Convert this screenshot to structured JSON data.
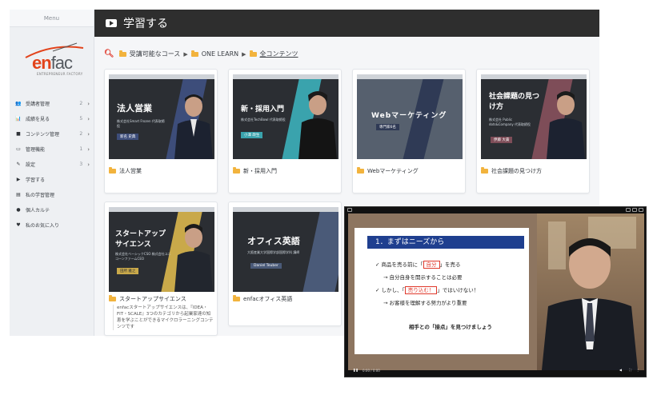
{
  "sidebar": {
    "menu_title": "Menu",
    "logo": {
      "en": "en",
      "fac": "fac",
      "tagline": "ENTREPRENEUR FACTORY"
    },
    "items": [
      {
        "icon": "users-icon",
        "glyph": "👥",
        "label": "受講者管理",
        "count": "2",
        "chevron": "›"
      },
      {
        "icon": "chart-icon",
        "glyph": "📊",
        "label": "成績を見る",
        "count": "5",
        "chevron": "›"
      },
      {
        "icon": "folder-icon",
        "glyph": "■",
        "label": "コンテンツ管理",
        "count": "2",
        "chevron": "›"
      },
      {
        "icon": "monitor-icon",
        "glyph": "▭",
        "label": "管理機能",
        "count": "1",
        "chevron": "›"
      },
      {
        "icon": "wrench-icon",
        "glyph": "✎",
        "label": "設定",
        "count": "3",
        "chevron": "›"
      },
      {
        "icon": "play-icon",
        "glyph": "▶",
        "label": "学習する",
        "count": "",
        "chevron": ""
      },
      {
        "icon": "bar-chart-icon",
        "glyph": "▤",
        "label": "私の学習管理",
        "count": "",
        "chevron": ""
      },
      {
        "icon": "id-card-icon",
        "glyph": "●",
        "label": "個人カルテ",
        "count": "",
        "chevron": ""
      },
      {
        "icon": "heart-icon",
        "glyph": "♥",
        "label": "私のお気に入り",
        "count": "",
        "chevron": ""
      }
    ]
  },
  "header": {
    "title": "学習する"
  },
  "breadcrumb": {
    "items": [
      "受講可能なコース",
      "ONE LEARN",
      "全コンテンツ"
    ]
  },
  "cards": [
    {
      "title": "法人営業",
      "thumb_title": "法人営業",
      "thumb_sub": "株式会社Smart Frozen 代表取締役",
      "thumb_name": "新名 史典",
      "bg": "#2b2e33",
      "accent": "#3d4d7a"
    },
    {
      "title": "新・採用入門",
      "thumb_title": "新・採用入門",
      "thumb_sub": "株式会社TechBowl 代表取締役",
      "thumb_name": "小澤 政生",
      "bg": "#2b2e33",
      "accent": "#3aa3ad"
    },
    {
      "title": "Webマーケティング",
      "thumb_title": "Webマーケティング",
      "thumb_name": "専門家6名",
      "bg": "#56606e",
      "accent": "#2f3a55"
    },
    {
      "title": "社会課題の見つけ方",
      "thumb_title": "社会課題の見つけ方",
      "thumb_sub": "株式会社 Public dots&Company 代表取締役",
      "thumb_name": "伊藤 大貴",
      "bg": "#2b2e33",
      "accent": "#7e4d58"
    },
    {
      "title": "スタートアップサイエンス",
      "thumb_title": "スタートアップサイエンス",
      "thumb_sub": "株式会社ベーシックCSO 株式会社ユニコーンファームCEO",
      "thumb_name": "田所 雅之",
      "bg": "#2b2e33",
      "accent": "#c9a94a",
      "desc": "enfacスタートアップサイエンスは、『IDEA・FIT・SCALE』3つのカテゴリから起業家達の知恵を学ぶことができるマイクロラーニングコンテンツです"
    },
    {
      "title": "enfacオフィス英語",
      "thumb_title": "オフィス英語",
      "thumb_sub": "大阪産業大学国際学部国際学科 講師",
      "thumb_name": "Daniel Teuber",
      "bg": "#2b2e33",
      "accent": "#4a5a78"
    }
  ],
  "player": {
    "slide_heading": "1．まずはニーズから",
    "line1_a": "✓ 商品を売る前に「",
    "line1_hl": "自分",
    "line1_b": "」を売る",
    "line2": "→ 自分自身を開示することは必要",
    "line3_a": "✓ しかし、「",
    "line3_hl": "売り込む！",
    "line3_b": "」ではいけない！",
    "line4": "→ お客様を理解する努力がより重要",
    "line5": "相手との「接点」を見つけましょう",
    "time": "0:00 / 0:00"
  },
  "colors": {
    "header_bg": "#2e2e2e",
    "sidebar_bg": "#eef0f3",
    "folder": "#f2b33d",
    "accent_red": "#e0392b"
  }
}
